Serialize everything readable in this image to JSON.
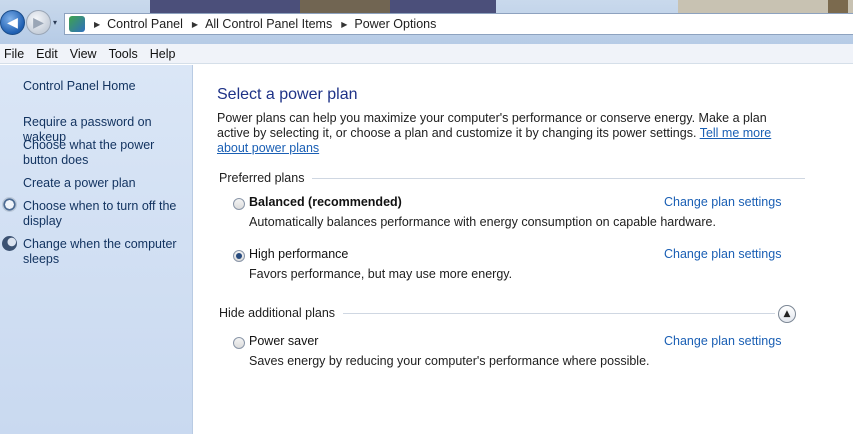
{
  "address": {
    "nav_back_glyph": "◀",
    "nav_forward_glyph": "▶",
    "history_glyph": "▾",
    "crumb_separator": "▶",
    "breadcrumbs": [
      "Control Panel",
      "All Control Panel Items",
      "Power Options"
    ]
  },
  "menu": [
    "File",
    "Edit",
    "View",
    "Tools",
    "Help"
  ],
  "sidebar": {
    "items": [
      {
        "label": "Control Panel Home",
        "icon": null
      },
      {
        "label": "Require a password on wakeup",
        "icon": null
      },
      {
        "label": "Choose what the power button does",
        "icon": null
      },
      {
        "label": "Create a power plan",
        "icon": null
      },
      {
        "label": "Choose when to turn off the display",
        "icon": "display-clock-icon"
      },
      {
        "label": "Change when the computer sleeps",
        "icon": "sleep-moon-icon"
      }
    ]
  },
  "main": {
    "title": "Select a power plan",
    "intro": "Power plans can help you maximize your computer's performance or conserve energy. Make a plan active by selecting it, or choose a plan and customize it by changing its power settings.",
    "intro_link": "Tell me more about power plans",
    "preferred_heading": "Preferred plans",
    "additional_heading": "Hide additional plans",
    "collapse_glyph": "▲",
    "change_label": "Change plan settings",
    "plans": [
      {
        "name": "Balanced (recommended)",
        "description": "Automatically balances performance with energy consumption on capable hardware.",
        "selected": false
      },
      {
        "name": "High performance",
        "description": "Favors performance, but may use more energy.",
        "selected": true
      },
      {
        "name": "Power saver",
        "description": "Saves energy by reducing your computer's performance where possible.",
        "selected": false
      }
    ]
  },
  "colors": {
    "link": "#1a5fb4",
    "title": "#1e3287",
    "sidebar_bg": "#dae6f6"
  }
}
